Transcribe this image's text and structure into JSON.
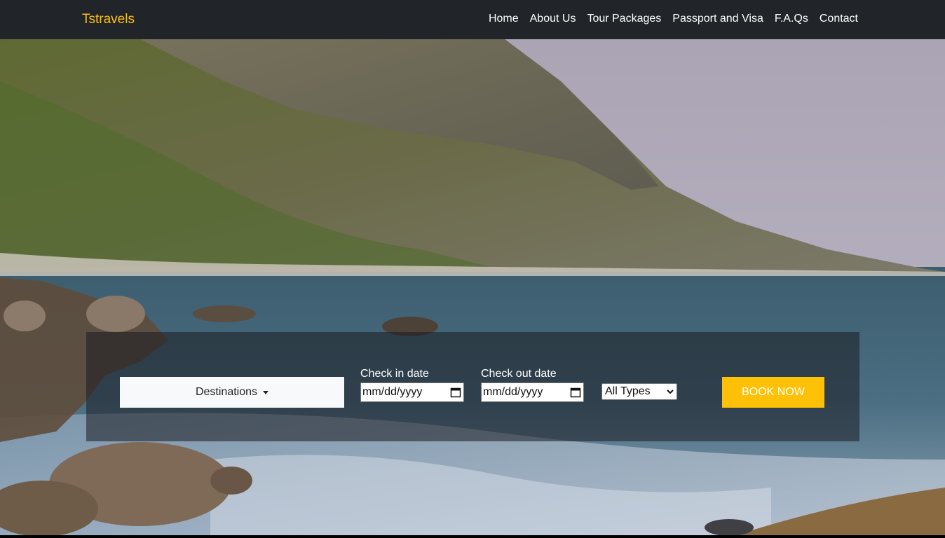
{
  "brand": "Tstravels",
  "nav": {
    "items": [
      "Home",
      "About Us",
      "Tour Packages",
      "Passport and Visa",
      "F.A.Qs",
      "Contact"
    ]
  },
  "booking": {
    "destinations_label": "Destinations",
    "check_in_label": "Check in date",
    "check_in_placeholder": "mm/dd/yyyy",
    "check_out_label": "Check out date",
    "check_out_placeholder": "mm/dd/yyyy",
    "type_selected": "All Types",
    "book_label": "BOOK NOW"
  },
  "colors": {
    "navbar": "#212529",
    "brand": "#ffc107",
    "accent_button": "#ffc107"
  },
  "icons": {
    "date": "calendar-icon",
    "dropdown": "caret-down-icon"
  }
}
